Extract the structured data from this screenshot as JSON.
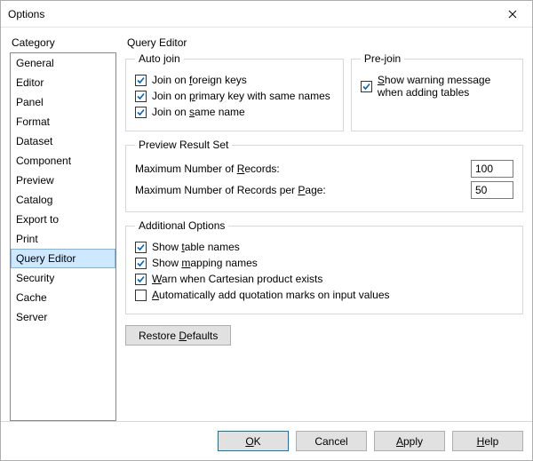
{
  "window": {
    "title": "Options"
  },
  "category": {
    "label": "Category",
    "items": [
      "General",
      "Editor",
      "Panel",
      "Format",
      "Dataset",
      "Component",
      "Preview",
      "Catalog",
      "Export to",
      "Print",
      "Query Editor",
      "Security",
      "Cache",
      "Server"
    ],
    "selected_index": 10
  },
  "page": {
    "title": "Query Editor",
    "auto_join": {
      "legend": "Auto join",
      "foreign_keys": {
        "label": "Join on foreign keys",
        "checked": true
      },
      "primary_key_same_names": {
        "label": "Join on primary key with same names",
        "checked": true
      },
      "same_name": {
        "label": "Join on same name",
        "checked": true
      }
    },
    "pre_join": {
      "legend": "Pre-join",
      "warn_on_add_tables": {
        "label": "Show warning message when adding tables",
        "checked": true
      }
    },
    "preview": {
      "legend": "Preview Result Set",
      "max_records": {
        "label": "Maximum Number of Records:",
        "value": "100"
      },
      "max_records_per_page": {
        "label": "Maximum Number of Records per Page:",
        "value": "50"
      }
    },
    "additional": {
      "legend": "Additional Options",
      "show_table_names": {
        "label": "Show table names",
        "checked": true
      },
      "show_mapping_names": {
        "label": "Show mapping names",
        "checked": true
      },
      "warn_cartesian": {
        "label": "Warn when Cartesian product exists",
        "checked": true
      },
      "auto_quote_input": {
        "label": "Automatically add quotation marks on input values",
        "checked": false
      }
    },
    "restore_defaults": "Restore Defaults"
  },
  "footer": {
    "ok": "OK",
    "cancel": "Cancel",
    "apply": "Apply",
    "help": "Help"
  }
}
